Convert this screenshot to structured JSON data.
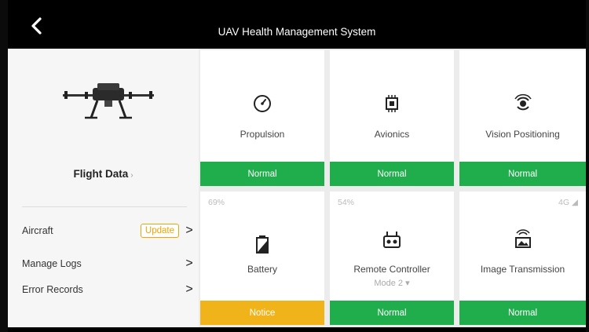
{
  "header": {
    "title": "UAV Health Management System"
  },
  "left_panel": {
    "flight_data_label": "Flight Data",
    "flight_data_arrow": "›",
    "menu": [
      {
        "label": "Aircraft",
        "button": "Update",
        "chevron": ">"
      },
      {
        "label": "Manage Logs",
        "chevron": ">"
      },
      {
        "label": "Error Records",
        "chevron": ">"
      }
    ]
  },
  "cards": [
    {
      "name": "Propulsion",
      "status": "Normal",
      "status_color": "#1fae4b",
      "icon": "speedometer-icon"
    },
    {
      "name": "Avionics",
      "status": "Normal",
      "status_color": "#1fae4b",
      "icon": "chip-icon"
    },
    {
      "name": "Vision Positioning",
      "status": "Normal",
      "status_color": "#1fae4b",
      "icon": "camera-lens-icon"
    },
    {
      "name": "Battery",
      "status": "Notice",
      "status_color": "#f0b31a",
      "icon": "battery-icon",
      "corner": "69%"
    },
    {
      "name": "Remote Controller",
      "status": "Normal",
      "status_color": "#1fae4b",
      "icon": "remote-controller-icon",
      "corner": "54%",
      "sub": "Mode 2 ▾"
    },
    {
      "name": "Image Transmission",
      "status": "Normal",
      "status_color": "#1fae4b",
      "icon": "image-transmission-icon",
      "corner": "4G ◢"
    }
  ]
}
